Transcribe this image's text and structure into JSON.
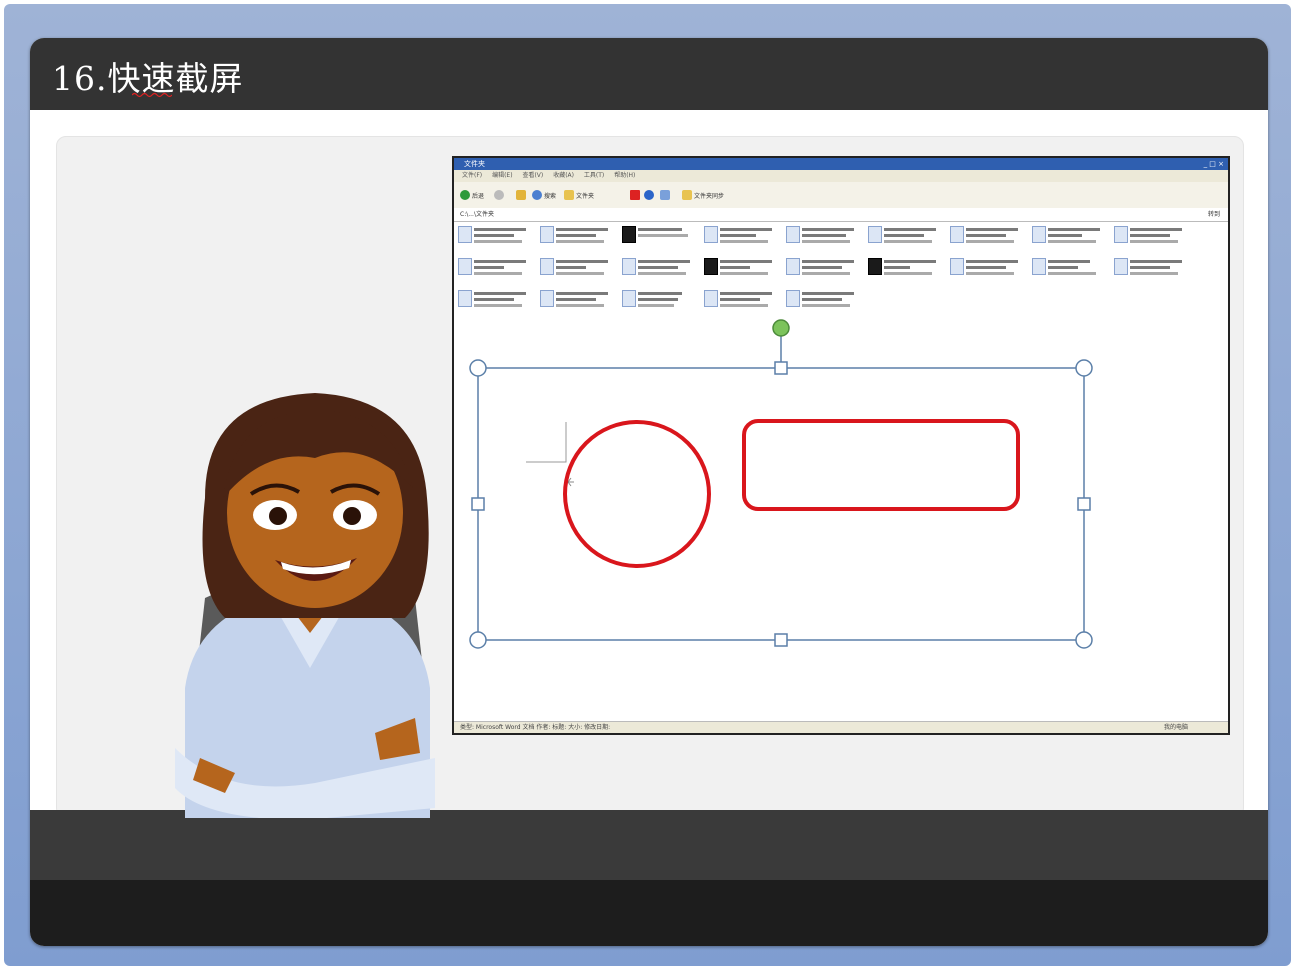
{
  "slide": {
    "title": "16.快速截屏"
  },
  "screenshot": {
    "window_title": "文件夹",
    "window_buttons": "_ □ ×",
    "menu_items": [
      "文件(F)",
      "编辑(E)",
      "查看(V)",
      "收藏(A)",
      "工具(T)",
      "帮助(H)"
    ],
    "toolbar": {
      "back": "后退",
      "search": "搜索",
      "folders": "文件夹",
      "sync": "文件夹同步"
    },
    "address_path": "C:\\...\\文件夹",
    "go_label": "转到",
    "status_left": "类型: Microsoft Word 文档 作者: 标题: 大小: 修改日期:",
    "status_right": "我的电脑"
  },
  "colors": {
    "title_bar": "#333333",
    "frame": "#8fa8d4",
    "shape_stroke": "#d9161c",
    "selection": "#5b7fa8",
    "rotate_handle": "#7cc35b"
  },
  "icons": [
    "back-icon",
    "forward-icon",
    "up-icon",
    "search-icon",
    "folder-icon",
    "delete-icon",
    "undo-icon",
    "views-icon"
  ]
}
